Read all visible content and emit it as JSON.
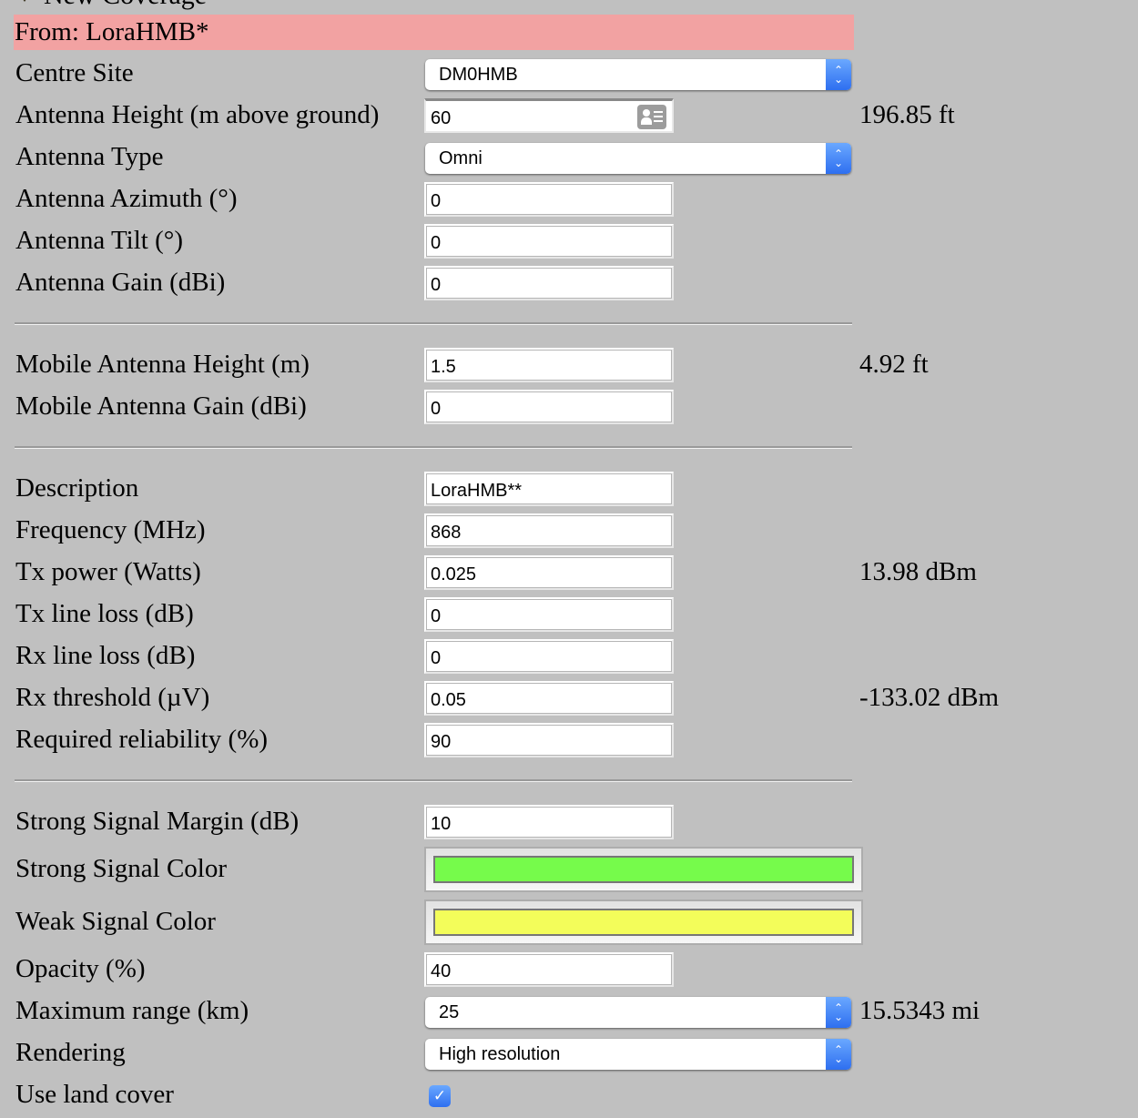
{
  "section_title": "New Coverage",
  "from_label": "From: LoraHMB*",
  "fields": {
    "centre_site": {
      "label": "Centre Site",
      "value": "DM0HMB"
    },
    "antenna_height": {
      "label": "Antenna Height (m above ground)",
      "value": "60",
      "aux": "196.85 ft"
    },
    "antenna_type": {
      "label": "Antenna Type",
      "value": "Omni"
    },
    "antenna_azimuth": {
      "label": "Antenna Azimuth (°)",
      "value": "0"
    },
    "antenna_tilt": {
      "label": "Antenna Tilt (°)",
      "value": "0"
    },
    "antenna_gain": {
      "label": "Antenna Gain (dBi)",
      "value": "0"
    },
    "mobile_antenna_height": {
      "label": "Mobile Antenna Height (m)",
      "value": "1.5",
      "aux": "4.92 ft"
    },
    "mobile_antenna_gain": {
      "label": "Mobile Antenna Gain (dBi)",
      "value": "0"
    },
    "description": {
      "label": "Description",
      "value": "LoraHMB**"
    },
    "frequency": {
      "label": "Frequency (MHz)",
      "value": "868"
    },
    "tx_power": {
      "label": "Tx power (Watts)",
      "value": "0.025",
      "aux": "13.98 dBm"
    },
    "tx_line_loss": {
      "label": "Tx line loss (dB)",
      "value": "0"
    },
    "rx_line_loss": {
      "label": "Rx line loss (dB)",
      "value": "0"
    },
    "rx_threshold": {
      "label": "Rx threshold (µV)",
      "value": "0.05",
      "aux": "-133.02 dBm"
    },
    "required_reliability": {
      "label": "Required reliability (%)",
      "value": "90"
    },
    "strong_signal_margin": {
      "label": "Strong Signal Margin (dB)",
      "value": "10"
    },
    "strong_signal_color": {
      "label": "Strong Signal Color",
      "color": "#76fb4b"
    },
    "weak_signal_color": {
      "label": "Weak Signal Color",
      "color": "#f3fd5a"
    },
    "opacity": {
      "label": "Opacity (%)",
      "value": "40"
    },
    "maximum_range": {
      "label": "Maximum range (km)",
      "value": "25",
      "aux": "15.5343 mi"
    },
    "rendering": {
      "label": "Rendering",
      "value": "High resolution"
    },
    "use_land_cover": {
      "label": "Use land cover",
      "checked": true,
      "check_glyph": "✓"
    }
  },
  "icons": {
    "select_arrows_up": "⌃",
    "select_arrows_down": "⌄"
  }
}
